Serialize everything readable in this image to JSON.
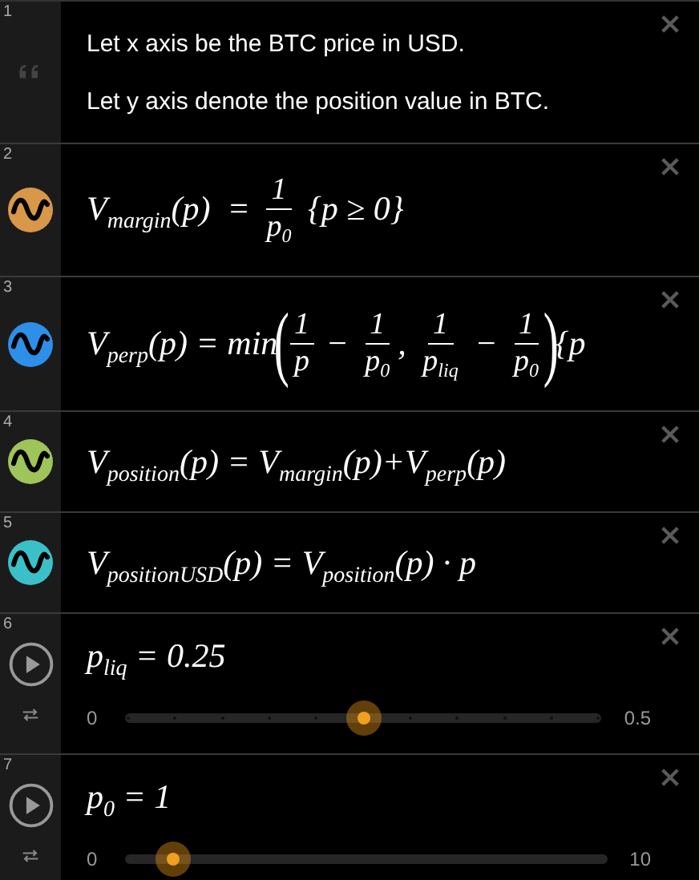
{
  "expressions": [
    {
      "kind": "note",
      "number": "1",
      "lines": [
        "Let x axis be the BTC price in USD.",
        "Let y axis denote the position value in BTC."
      ]
    },
    {
      "kind": "expression",
      "number": "2",
      "color": "#d9974a",
      "math": [
        {
          "kind": "text",
          "text": "V$_{margin}$(p)  = "
        },
        {
          "kind": "frac",
          "num": "1",
          "den": "p$_{0}$"
        },
        {
          "kind": "text",
          "text": " {p ≥ 0}"
        }
      ]
    },
    {
      "kind": "expression",
      "number": "3",
      "color": "#2d8fe8",
      "math": [
        {
          "kind": "text",
          "text": "V$_{perp}$(p) = min"
        },
        {
          "kind": "big",
          "text": "("
        },
        {
          "kind": "frac",
          "num": "1",
          "den": "p"
        },
        {
          "kind": "text",
          "text": " − "
        },
        {
          "kind": "frac",
          "num": "1",
          "den": "p$_{0}$"
        },
        {
          "kind": "text",
          "text": ", "
        },
        {
          "kind": "frac",
          "num": "1",
          "den": "p$_{liq}$"
        },
        {
          "kind": "text",
          "text": " − "
        },
        {
          "kind": "frac",
          "num": "1",
          "den": "p$_{0}$"
        },
        {
          "kind": "big",
          "text": ")"
        },
        {
          "kind": "text",
          "text": "{p"
        }
      ]
    },
    {
      "kind": "expression",
      "number": "4",
      "color": "#9ec45a",
      "math": [
        {
          "kind": "text",
          "text": "V$_{position}$(p) = V$_{margin}$(p)+V$_{perp}$(p)"
        }
      ]
    },
    {
      "kind": "expression",
      "number": "5",
      "color": "#3cc0c8",
      "math": [
        {
          "kind": "text",
          "text": "V$_{positionUSD}$(p) = V$_{position}$(p) · p"
        }
      ]
    },
    {
      "kind": "slider",
      "number": "6",
      "math": [
        {
          "kind": "text",
          "text": "p$_{liq}$ = 0.25"
        }
      ],
      "min": "0",
      "max": "0.5",
      "level": 0.5,
      "step_marks": true
    },
    {
      "kind": "slider",
      "number": "7",
      "math": [
        {
          "kind": "text",
          "text": "p$_{0}$ = 1"
        }
      ],
      "min": "0",
      "max": "10",
      "level": 0.1,
      "step_marks": false
    }
  ]
}
